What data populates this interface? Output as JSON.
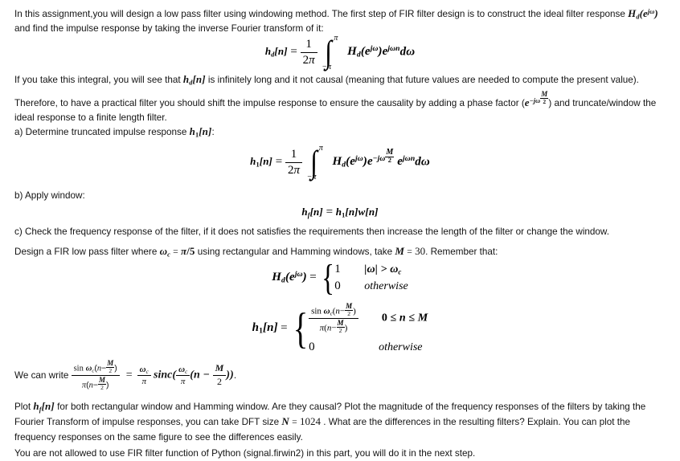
{
  "document": {
    "type": "homework-assignment",
    "topic": "FIR low pass filter design using windowing method",
    "background_color": "#ffffff",
    "text_color": "#141414"
  },
  "paragraphs": {
    "intro_part1": "In this assignment,you will design a low pass filter using windowing method. The first step of FIR filter design is to construct the ideal filter response ",
    "intro_part2": " and find the impulse response by taking the inverse Fourier transform of it:",
    "integral_note": "If you take this integral, you will see that ",
    "integral_note2": " is infinitely long and it not causal (meaning that future values are needed to compute the present value).",
    "causality_part1": "Therefore, to have a practical filter you should shift the impulse response to ensure the causality by adding a phase factor (",
    "causality_part2": ") and truncate/window the ideal response to a finite length filter.",
    "part_a": "a) Determine truncated impulse response ",
    "part_a_end": ":",
    "part_b": "b) Apply window:",
    "part_c": "c) Check the frequency response of the filter, if it does not satisfies the requirements then increase the length of the filter or change the window.",
    "design_part1": "Design a FIR low pass filter where ",
    "design_part2": " using rectangular and Hamming windows, take ",
    "design_part3": ". Remember that:",
    "we_can_write": "We can write ",
    "we_can_write_end": ".",
    "plot_part1": "Plot ",
    "plot_part2": " for both rectangular window and Hamming window. Are they causal? Plot the magnitude of the frequency responses of the filters by taking the Fourier Transform of impulse responses, you can take DFT size ",
    "plot_part3": " . What are the differences in the resulting filters? Explain. You can plot the frequency responses on the same figure to see the differences easily.",
    "restriction": "You are not allowed to use FIR filter function of Python (signal.firwin2) in this part, you will do it in the next step."
  },
  "symbols": {
    "Hd_ejw": "H_d(e^{jω})",
    "hd_n": "h_d[n]",
    "h1_n": "h₁[n]",
    "hf_n": "h_f[n]",
    "phase_factor": "e^{-jω M/2}",
    "omega_c": "ω_c",
    "pi": "π"
  },
  "values": {
    "cutoff_frequency": "π/5",
    "filter_order_M": "30",
    "dft_size_N": "1024",
    "one_over_2pi": "1/2π",
    "integral_lower_limit": "-π",
    "integral_upper_limit": "π",
    "case_value_1": "1",
    "case_value_0": "0",
    "case_condition_1": "|ω| > ω_c",
    "case_condition_otherwise": "otherwise",
    "range_condition": "0 ≤ n ≤ M"
  },
  "equations": {
    "eq_hd": "h_d[n] = (1/2π) ∫_{-π}^{π} H_d(e^{jω}) e^{jωn} dω",
    "eq_h1": "h₁[n] = (1/2π) ∫_{-π}^{π} H_d(e^{jω}) e^{-jω M/2} e^{jωn} dω",
    "eq_hf": "h_f[n] = h₁[n] w[n]",
    "eq_Hd_cases": "H_d(e^{jω}) = { 1 if |ω| > ω_c ; 0 otherwise }",
    "eq_h1_cases": "h₁[n] = { sin ω_c(n - M/2) / π(n - M/2) for 0 ≤ n ≤ M ; 0 otherwise }",
    "eq_sinc": "sin ω_c(n - M/2) / π(n - M/2) = (ω_c/π) sinc((ω_c/π)(n - M/2))"
  },
  "labels": {
    "sin": "sin",
    "sinc": "sinc",
    "otherwise": "otherwise",
    "dw": "dω",
    "equals": "=",
    "w_of_n": "w[n]"
  }
}
